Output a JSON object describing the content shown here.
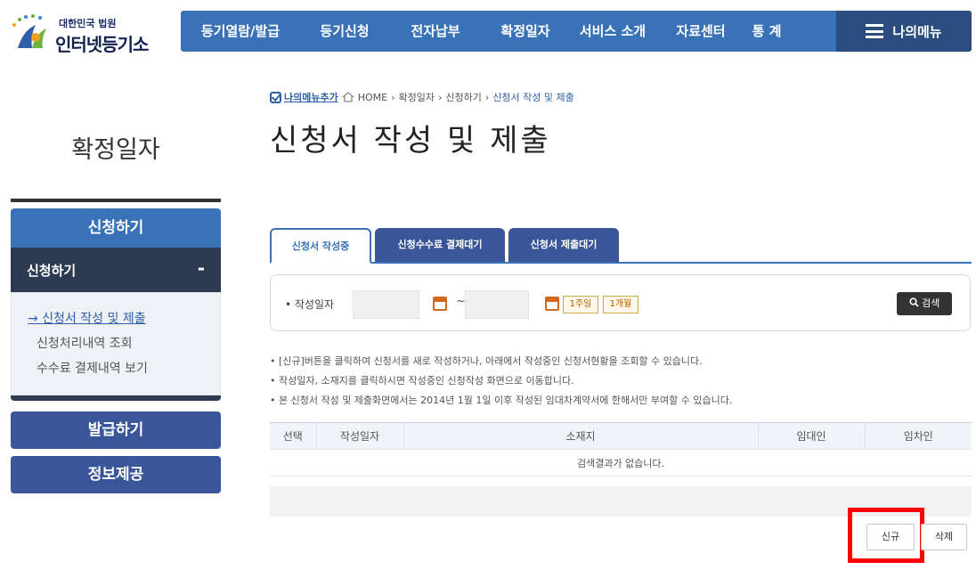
{
  "header": {
    "logo_sub": "대한민국 법원",
    "logo_main": "인터넷등기소",
    "menus": [
      "등기열람/발급",
      "등기신청",
      "전자납부",
      "확정일자",
      "서비스 소개",
      "자료센터",
      "통 계"
    ],
    "my_menu": "나의메뉴"
  },
  "sidebar": {
    "title": "확정일자",
    "section": "신청하기",
    "sub_section": "신청하기",
    "collapse_symbol": "-",
    "items": [
      {
        "label": "→ 신청서 작성 및 제출",
        "active": true
      },
      {
        "label": "신청처리내역 조회",
        "active": false
      },
      {
        "label": "수수료 결제내역 보기",
        "active": false
      }
    ],
    "bottom_buttons": [
      "발급하기",
      "정보제공"
    ]
  },
  "breadcrumb": {
    "my_menu_add": "나의메뉴추가",
    "items": [
      "HOME",
      "확정일자",
      "신청하기",
      "신청서 작성 및 제출"
    ]
  },
  "page_title": "신청서 작성 및 제출",
  "tabs": [
    "신청서 작성중",
    "신청수수료 결제대기",
    "신청서 제출대기"
  ],
  "search": {
    "label": "• 작성일자",
    "from_value": "",
    "tilde": "~",
    "to_value": "",
    "period_buttons": [
      "1주일",
      "1개월"
    ],
    "search_button": "검색"
  },
  "notices": [
    "• [신규]버튼을 클릭하여 신청서를 새로 작성하거나, 아래에서 작성중인 신청서현황을 조회할 수 있습니다.",
    "• 작성일자, 소재지를 클릭하시면 작성중인 신청작성 화면으로 이동합니다.",
    "• 본 신청서 작성 및 제출화면에서는 2014년 1월 1일 이후 작성된 임대차계약서에 한해서만 부여할 수 있습니다."
  ],
  "table": {
    "headers": [
      "선택",
      "작성일자",
      "소재지",
      "임대인",
      "임차인"
    ],
    "empty_message": "검색결과가 없습니다."
  },
  "buttons": {
    "new": "신규",
    "delete": "삭제"
  },
  "colors": {
    "nav_blue": "#3a72b8",
    "sidebar_dark": "#2c3a52",
    "highlight": "#ff0000"
  }
}
